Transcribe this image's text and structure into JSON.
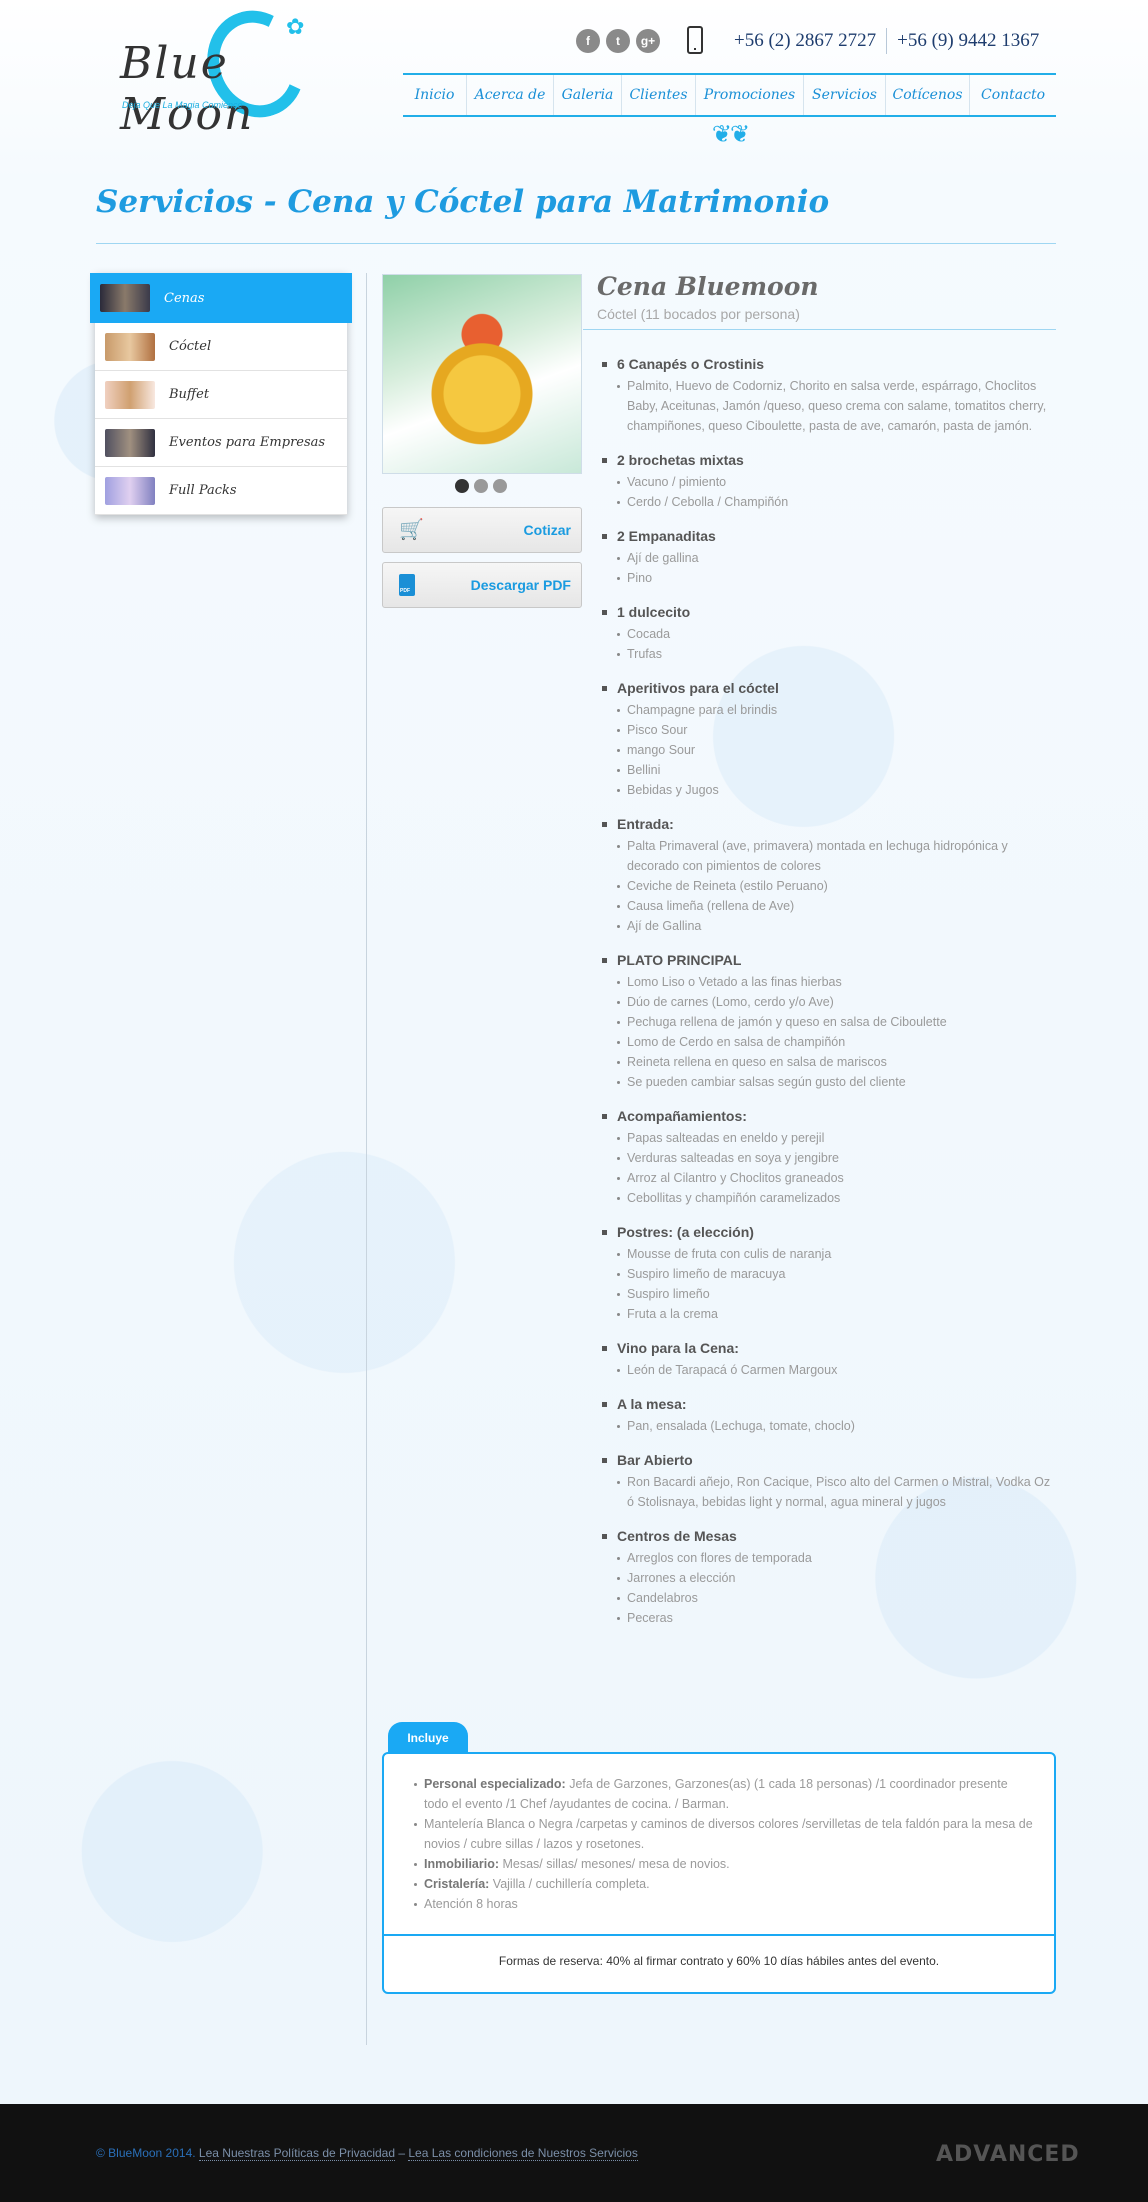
{
  "header": {
    "logo_text": "Blue Moon",
    "logo_tagline": "Deja Que La Magia Comience",
    "social": [
      {
        "icon": "facebook-icon",
        "glyph": "f"
      },
      {
        "icon": "twitter-icon",
        "glyph": "t"
      },
      {
        "icon": "google-plus-icon",
        "glyph": "g+"
      }
    ],
    "phone_1": "+56 (2) 2867 2727",
    "phone_2": "+56 (9) 9442 1367"
  },
  "nav": [
    "Inicio",
    "Acerca de",
    "Galeria",
    "Clientes",
    "Promociones",
    "Servicios",
    "Cotícenos",
    "Contacto"
  ],
  "page_title": "Servicios - Cena y Cóctel para Matrimonio",
  "sidebar": [
    {
      "label": "Cenas",
      "active": true
    },
    {
      "label": "Cóctel",
      "active": false
    },
    {
      "label": "Buffet",
      "active": false
    },
    {
      "label": "Eventos para Empresas",
      "active": false
    },
    {
      "label": "Full Packs",
      "active": false
    }
  ],
  "product": {
    "title": "Cena Bluemoon",
    "subtitle": "Cóctel (11 bocados por persona)",
    "carousel_dots": 3,
    "active_dot": 0,
    "quote_button": "Cotizar",
    "pdf_button": "Descargar PDF"
  },
  "menu": [
    {
      "title": "6 Canapés o Crostinis",
      "items": [
        "Palmito, Huevo de Codorniz, Chorito en salsa verde, espárrago, Choclitos Baby, Aceitunas, Jamón /queso, queso crema con salame, tomatitos cherry, champiñones, queso Ciboulette, pasta de ave, camarón, pasta de jamón."
      ]
    },
    {
      "title": "2 brochetas mixtas",
      "items": [
        "Vacuno / pimiento",
        "Cerdo / Cebolla / Champiñón"
      ]
    },
    {
      "title": "2 Empanaditas",
      "items": [
        "Ají de gallina",
        "Pino"
      ]
    },
    {
      "title": "1 dulcecito",
      "items": [
        "Cocada",
        "Trufas"
      ]
    },
    {
      "title": "Aperitivos para el cóctel",
      "items": [
        "Champagne para el brindis",
        "Pisco Sour",
        "mango Sour",
        "Bellini",
        "Bebidas y Jugos"
      ]
    },
    {
      "title": "Entrada:",
      "items": [
        "Palta Primaveral (ave, primavera) montada en lechuga hidropónica y decorado con pimientos de colores",
        "Ceviche de Reineta (estilo Peruano)",
        "Causa limeña (rellena de Ave)",
        "Ají de Gallina"
      ]
    },
    {
      "title": "PLATO PRINCIPAL",
      "items": [
        "Lomo Liso o Vetado a las finas hierbas",
        "Dúo de carnes (Lomo, cerdo y/o Ave)",
        "Pechuga rellena de jamón y queso en salsa de Ciboulette",
        "Lomo de Cerdo en salsa de champiñón",
        "Reineta rellena en queso en salsa de mariscos",
        "Se pueden cambiar salsas según gusto del cliente"
      ]
    },
    {
      "title": "Acompañamientos:",
      "items": [
        "Papas salteadas en eneldo y perejil",
        "Verduras salteadas en soya y jengibre",
        "Arroz al Cilantro y Choclitos graneados",
        "Cebollitas y champiñón caramelizados"
      ]
    },
    {
      "title": "Postres: (a elección)",
      "items": [
        "Mousse de fruta con culis de naranja",
        "Suspiro limeño de maracuya",
        "Suspiro limeño",
        "Fruta a la crema"
      ]
    },
    {
      "title": "Vino para la Cena:",
      "items": [
        "León de Tarapacá ó Carmen Margoux"
      ]
    },
    {
      "title": "A la mesa:",
      "items": [
        "Pan, ensalada (Lechuga, tomate, choclo)"
      ]
    },
    {
      "title": "Bar Abierto",
      "items": [
        "Ron Bacardi añejo, Ron Cacique, Pisco alto del Carmen o Mistral, Vodka Oz ó Stolisnaya, bebidas light y normal, agua mineral y jugos"
      ]
    },
    {
      "title": "Centros de Mesas",
      "items": [
        "Arreglos con flores de temporada",
        "Jarrones a elección",
        "Candelabros",
        "Peceras"
      ]
    }
  ],
  "includes": {
    "tab": "Incluye",
    "items": [
      {
        "bold": "Personal especializado:",
        "text": " Jefa de Garzones, Garzones(as) (1 cada 18 personas) /1 coordinador presente todo el evento /1 Chef /ayudantes de cocina. / Barman."
      },
      {
        "bold": "",
        "text": "Mantelería Blanca o Negra /carpetas y caminos de diversos colores /servilletas de tela faldón para la mesa de novios / cubre sillas / lazos y rosetones."
      },
      {
        "bold": "Inmobiliario:",
        "text": " Mesas/ sillas/ mesones/ mesa de novios."
      },
      {
        "bold": "Cristalería:",
        "text": " Vajilla / cuchillería completa."
      },
      {
        "bold": "",
        "text": "Atención 8 horas"
      }
    ],
    "reservation": "Formas de reserva: 40% al firmar contrato y 60% 10 días hábiles antes del evento."
  },
  "footer": {
    "copyright": "© BlueMoon 2014.",
    "privacy_link": "Lea Nuestras Políticas de Privacidad",
    "separator": " – ",
    "terms_link": "Lea Las condiciones de Nuestros Servicios",
    "brand": "ADVANCED"
  }
}
